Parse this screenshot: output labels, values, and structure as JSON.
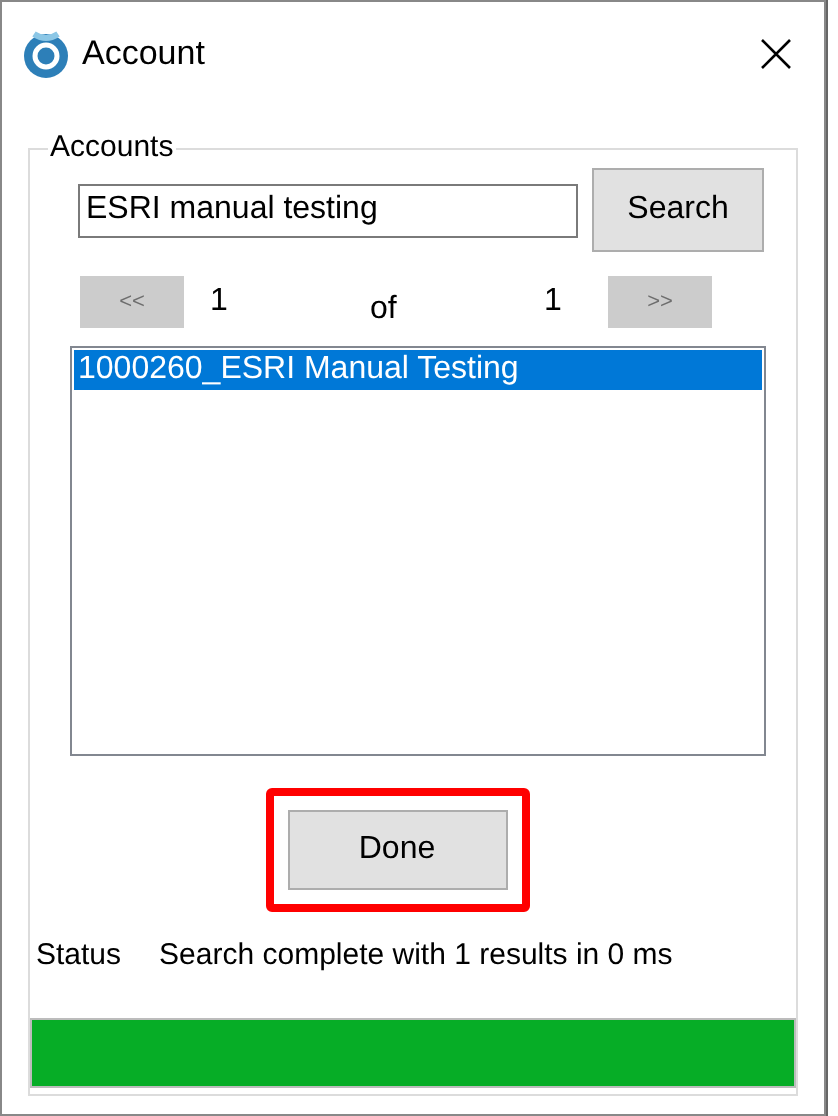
{
  "window": {
    "title": "Account"
  },
  "group": {
    "legend": "Accounts"
  },
  "search": {
    "value": "ESRI manual testing",
    "button": "Search"
  },
  "pager": {
    "prev": "<<",
    "current": "1",
    "of": "of",
    "total": "1",
    "next": ">>"
  },
  "results": [
    {
      "label": "1000260_ESRI Manual Testing",
      "selected": true
    }
  ],
  "done_button": {
    "label": "Done",
    "highlighted": true
  },
  "status": {
    "label": "Status",
    "message": "Search complete with 1 results in 0 ms"
  },
  "progress": {
    "level": 1
  }
}
